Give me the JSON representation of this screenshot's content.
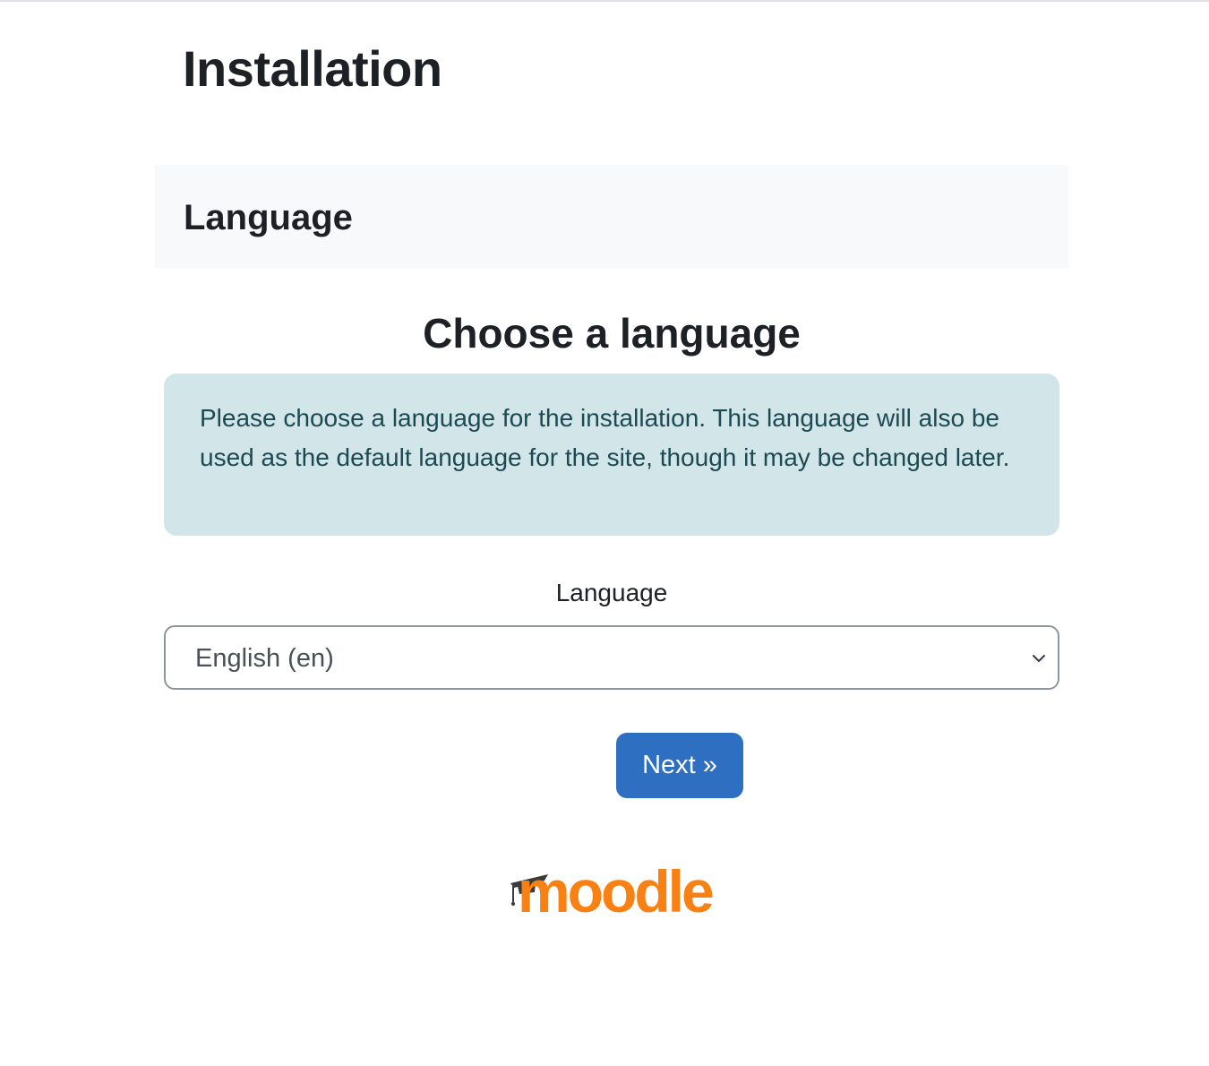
{
  "page": {
    "title": "Installation"
  },
  "section": {
    "title": "Language"
  },
  "form": {
    "heading": "Choose a language",
    "info_text": "Please choose a language for the installation. This language will also be used as the default language for the site, though it may be changed later.",
    "language_label": "Language",
    "language_selected": "English (en)",
    "next_label": "Next »"
  },
  "footer": {
    "logo_text": "moodle",
    "logo_color": "#f98012"
  },
  "colors": {
    "primary_button": "#2f6fc1",
    "info_background": "#d2e5e8",
    "info_text": "#1c4a52",
    "section_background": "#f8f9fa"
  }
}
